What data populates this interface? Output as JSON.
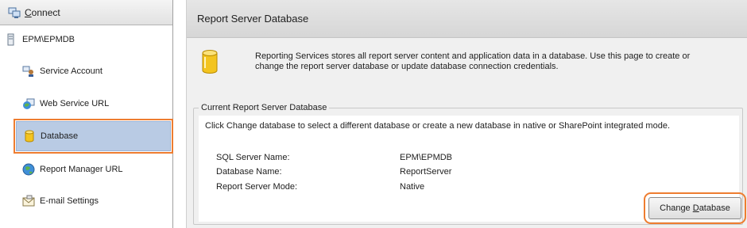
{
  "nav": {
    "connect_label_first": "C",
    "connect_label_rest": "onnect",
    "server": "EPM\\EPMDB",
    "items": [
      {
        "label": "Service Account",
        "icon": "service-account-icon"
      },
      {
        "label": "Web Service URL",
        "icon": "web-service-icon"
      },
      {
        "label": "Database",
        "icon": "database-icon"
      },
      {
        "label": "Report Manager URL",
        "icon": "globe-icon"
      },
      {
        "label": "E-mail Settings",
        "icon": "email-icon"
      }
    ],
    "selected_index": 2
  },
  "page": {
    "title": "Report Server Database",
    "intro_line1": "Reporting Services stores all report server content and application data in a database. Use this page to create or",
    "intro_line2": "change the report server database or update database connection credentials."
  },
  "group": {
    "legend": "Current Report Server Database",
    "description": "Click Change database to select a different database or create a new database in native or SharePoint integrated mode.",
    "rows": [
      {
        "label": "SQL Server Name:",
        "value": "EPM\\EPMDB"
      },
      {
        "label": "Database Name:",
        "value": "ReportServer"
      },
      {
        "label": "Report Server Mode:",
        "value": "Native"
      }
    ],
    "button_prefix": "Change ",
    "button_ul": "D",
    "button_suffix": "atabase"
  },
  "colors": {
    "highlight_orange": "#ee7d30",
    "selection_blue": "#b9cbe4",
    "database_yellow": "#f3c41f"
  }
}
